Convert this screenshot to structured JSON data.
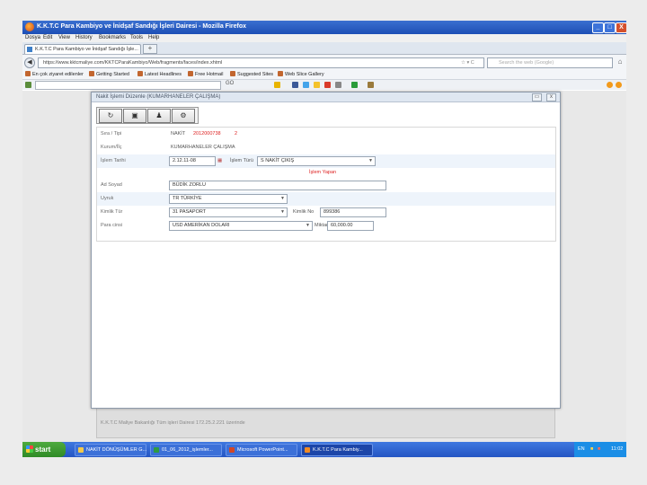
{
  "window": {
    "title": "K.K.T.C Para Kambiyo ve İnidşaf Sandığı İşleri Dairesi - Mozilla Firefox",
    "min": "_",
    "max": "□",
    "close": "X"
  },
  "menu": [
    "Dosya",
    "Edit",
    "View",
    "History",
    "Bookmarks",
    "Tools",
    "Help"
  ],
  "tab": {
    "label": "K.K.T.C Para Kambiyo ve İnidşaf Sandığı İşle...",
    "newtab": "+"
  },
  "nav": {
    "back": "◀",
    "url": "https://www.kktcmaliye.com/KKTCParaKambiyo/Web/fragments/faces/index.xhtml",
    "star": "☆ ▾ C",
    "search_placeholder": "Search the web (Google)",
    "home": "⌂"
  },
  "bookmarks": [
    "En çok ziyaret edilenler",
    "Getting Started",
    "Latest Headlines",
    "Free Hotmail",
    "Suggested Sites",
    "Web Slice Gallery"
  ],
  "toolbar2": {
    "go": "GO"
  },
  "dialog": {
    "title": "Nakit İşlemi Düzenle (KUMARHANELER ÇALIŞMA)",
    "tools": [
      "↻",
      "▣",
      "♟",
      "⚙"
    ],
    "btn_min": "▭",
    "btn_close": "x"
  },
  "form": {
    "sira_label": "Sıra / Tipi",
    "sira_type": "NAKİT",
    "sira_no": "2012000738",
    "sira_seq": "2",
    "kurum_label": "Kurum/İİç",
    "kurum_value": "KUMARHANELER ÇALIŞMA",
    "tarih_label": "İşlem Tarihi",
    "tarih_value": "2.12.11-08",
    "turu_label": "İşlem Türü",
    "turu_value": "S NAKİT ÇIKIŞ",
    "status": "İşlem Yapan",
    "ad_label": "Ad Soyad",
    "ad_value": "BÜDİK ZORLU",
    "uyruk_label": "Uyruk",
    "uyruk_value": "TR TÜRKİYE",
    "kimlik_tur_label": "Kimlik Tür",
    "kimlik_tur_value": "31 PASAPORT",
    "kimlik_no_label": "Kimlik No",
    "kimlik_no_value": "899386",
    "para_label": "Para cinsi",
    "para_value": "USD AMERİKAN DOLARI",
    "miktar_label": "Miktar",
    "miktar_value": "60,000.00"
  },
  "background_footer": "K.K.T.C Maliye Bakanlığı Tüm işleri Dairesi 172.25.2.221 üzerinde",
  "taskbar": {
    "start": "start",
    "items": [
      "NAKİT DÖNÜŞÜMLER G...",
      "01_06_2012_işlemler...",
      "Microsoft PowerPoint...",
      "K.K.T.C Para Kambiy..."
    ],
    "lang": "EN",
    "time": "11:02"
  }
}
